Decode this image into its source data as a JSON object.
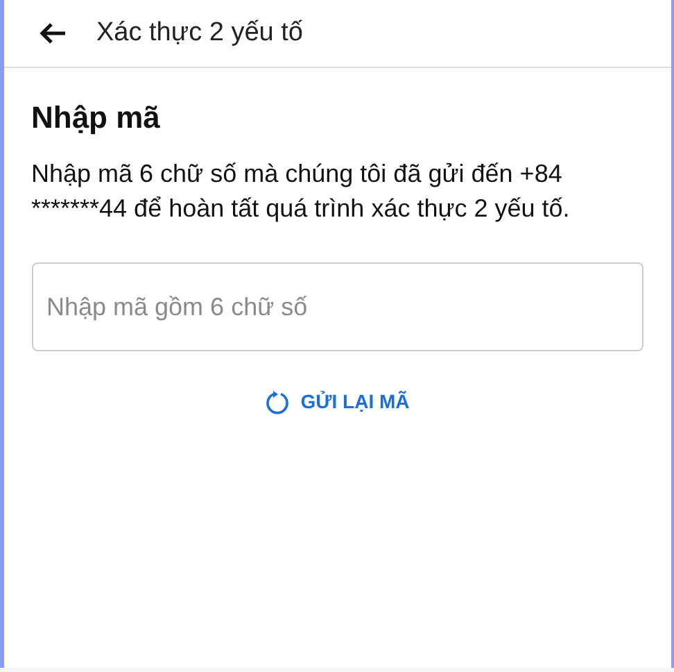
{
  "header": {
    "title": "Xác thực 2 yếu tố"
  },
  "heading": "Nhập mã",
  "description": "Nhập mã 6 chữ số mà chúng tôi đã gửi đến +84 *******44 để hoàn tất quá trình xác thực 2 yếu tố.",
  "code_field": {
    "placeholder": "Nhập mã gồm 6 chữ số"
  },
  "resend_button": {
    "label": "GỬI LẠI MÃ"
  }
}
